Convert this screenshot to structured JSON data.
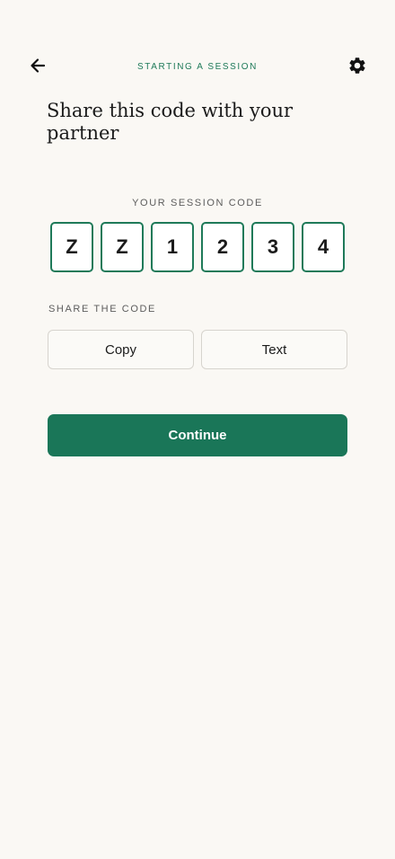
{
  "header": {
    "eyebrow": "STARTING A SESSION",
    "back_icon": "arrow-left-icon",
    "settings_icon": "gear-icon"
  },
  "title": "Share this code with your partner",
  "session_code": {
    "label": "YOUR SESSION CODE",
    "characters": [
      "Z",
      "Z",
      "1",
      "2",
      "3",
      "4"
    ]
  },
  "share": {
    "label": "SHARE THE CODE",
    "copy_label": "Copy",
    "text_label": "Text"
  },
  "continue_label": "Continue",
  "colors": {
    "background": "#faf8f4",
    "accent": "#1a7658",
    "border": "#d7d4ce"
  }
}
